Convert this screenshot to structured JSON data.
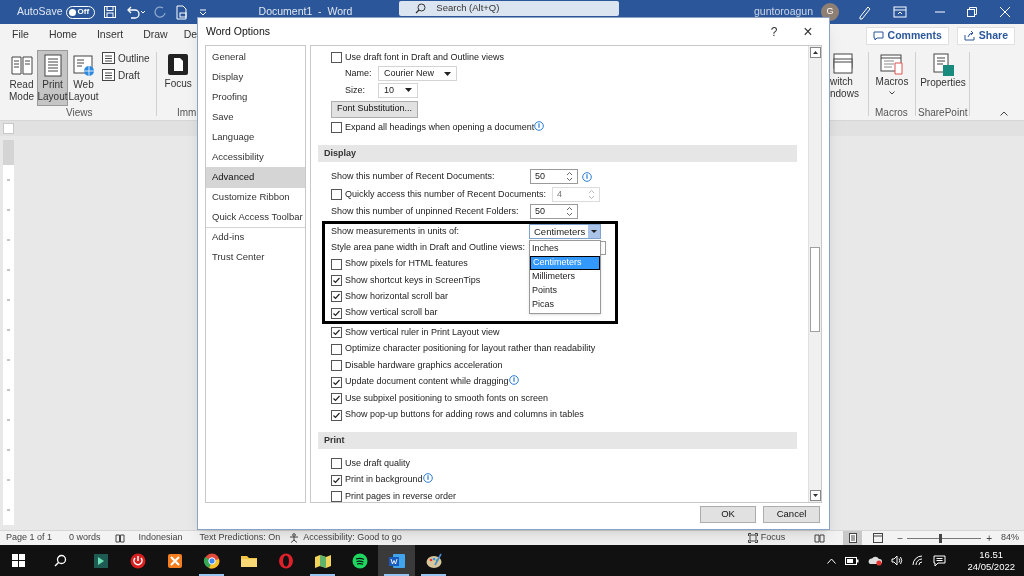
{
  "title_bar": {
    "autosave": "AutoSave",
    "autosave_toggle": {
      "label": "Off",
      "on": false
    },
    "document_title": "Document1  -  Word",
    "search": {
      "placeholder": "Search (Alt+Q)"
    },
    "user_name": "guntoroagun",
    "avatar": "G"
  },
  "ribbon": {
    "tabs": [
      {
        "label": "File",
        "selected": false
      },
      {
        "label": "Home",
        "selected": false
      },
      {
        "label": "Insert",
        "selected": false
      },
      {
        "label": "Draw",
        "selected": false
      },
      {
        "label": "De",
        "selected": false
      }
    ],
    "comments_button": "Comments",
    "share_button": "Share",
    "views": {
      "label": "Views",
      "large_buttons": [
        {
          "label": "Read Mode",
          "selected": false
        },
        {
          "label": "Print Layout",
          "selected": true
        },
        {
          "label": "Web Layout",
          "selected": false
        }
      ],
      "small_buttons": [
        "Outline",
        "Draft"
      ]
    },
    "immersive": {
      "label": "Imm",
      "button": "Focus"
    },
    "window": {
      "lines": [
        "witch",
        "ndows"
      ]
    },
    "macros": {
      "label": "Macros",
      "button": "Macros"
    },
    "sharepoint": {
      "label": "SharePoint",
      "button": "Properties"
    }
  },
  "dialog": {
    "title": "Word Options",
    "help": "?",
    "close": "×",
    "nav": [
      {
        "label": "General",
        "selected": false,
        "divider_above": false
      },
      {
        "label": "Display",
        "selected": false,
        "divider_above": false
      },
      {
        "label": "Proofing",
        "selected": false,
        "divider_above": false
      },
      {
        "label": "Save",
        "selected": false,
        "divider_above": false
      },
      {
        "label": "Language",
        "selected": false,
        "divider_above": false
      },
      {
        "label": "Accessibility",
        "selected": false,
        "divider_above": false
      },
      {
        "label": "Advanced",
        "selected": true,
        "divider_above": false
      },
      {
        "label": "Customize Ribbon",
        "selected": false,
        "divider_above": true
      },
      {
        "label": "Quick Access Toolbar",
        "selected": false,
        "divider_above": false
      },
      {
        "label": "Add-ins",
        "selected": false,
        "divider_above": true
      },
      {
        "label": "Trust Center",
        "selected": false,
        "divider_above": false
      }
    ],
    "rows": [
      {
        "kind": "checkbox",
        "label": "Use draft font in Draft and Outline views",
        "checked": false,
        "info": false
      },
      {
        "kind": "select",
        "label": "Name:",
        "value": "Courier New"
      },
      {
        "kind": "select",
        "label": "Size:",
        "value": "10"
      },
      {
        "kind": "button",
        "label": "Font Substitution..."
      },
      {
        "kind": "checkbox",
        "label": "Expand all headings when opening a document",
        "checked": false,
        "info": true
      },
      {
        "kind": "section",
        "label": "Display"
      },
      {
        "kind": "spin",
        "label": "Show this number of Recent Documents:",
        "value": "50",
        "disabled": false,
        "info": true
      },
      {
        "kind": "check-spin",
        "label": "Quickly access this number of Recent Documents:",
        "checked": false,
        "value": "4",
        "disabled": true
      },
      {
        "kind": "spin",
        "label": "Show this number of unpinned Recent Folders:",
        "value": "50",
        "disabled": false,
        "info": false
      },
      {
        "kind": "highlight",
        "rows": [
          {
            "kind": "dropdown",
            "label": "Show measurements in units of:",
            "value": "Centimeters",
            "expanded": true,
            "options": [
              {
                "label": "Inches",
                "selected": false
              },
              {
                "label": "Centimeters",
                "selected": true
              },
              {
                "label": "Millimeters",
                "selected": false
              },
              {
                "label": "Points",
                "selected": false
              },
              {
                "label": "Picas",
                "selected": false
              }
            ]
          },
          {
            "kind": "field",
            "label": "Style area pane width in Draft and Outline views:"
          },
          {
            "kind": "checkbox",
            "label": "Show pixels for HTML features",
            "checked": false,
            "info": false
          },
          {
            "kind": "checkbox",
            "label": "Show shortcut keys in ScreenTips",
            "checked": true,
            "info": false
          },
          {
            "kind": "checkbox",
            "label": "Show horizontal scroll bar",
            "checked": true,
            "info": false
          },
          {
            "kind": "checkbox",
            "label": "Show vertical scroll bar",
            "checked": true,
            "info": false
          }
        ]
      },
      {
        "kind": "checkbox",
        "label": "Show vertical ruler in Print Layout view",
        "checked": true,
        "info": false
      },
      {
        "kind": "checkbox",
        "label": "Optimize character positioning for layout rather than readability",
        "checked": false,
        "info": false
      },
      {
        "kind": "checkbox",
        "label": "Disable hardware graphics acceleration",
        "checked": false,
        "info": false
      },
      {
        "kind": "checkbox",
        "label": "Update document content while dragging",
        "checked": true,
        "info": true
      },
      {
        "kind": "checkbox",
        "label": "Use subpixel positioning to smooth fonts on screen",
        "checked": true,
        "info": false
      },
      {
        "kind": "checkbox",
        "label": "Show pop-up buttons for adding rows and columns in tables",
        "checked": true,
        "info": false
      },
      {
        "kind": "section",
        "label": "Print"
      },
      {
        "kind": "checkbox",
        "label": "Use draft quality",
        "checked": false,
        "info": false
      },
      {
        "kind": "checkbox",
        "label": "Print in background",
        "checked": true,
        "info": true
      },
      {
        "kind": "checkbox",
        "label": "Print pages in reverse order",
        "checked": false,
        "info": false
      }
    ],
    "buttons": [
      "OK",
      "Cancel"
    ]
  },
  "status_bar": {
    "page": "Page 1 of 1",
    "words": "0 words",
    "language": "Indonesian",
    "text_predictions": "Text Predictions: On",
    "accessibility": "Accessibility: Good to go",
    "focus": "Focus",
    "zoom_out": "−",
    "zoom": {
      "level": 0.43
    },
    "zoom_in": "+",
    "zoom_percent": "84%"
  },
  "taskbar": {
    "apps": [
      {
        "running": false,
        "active": false
      },
      {
        "running": false,
        "active": false
      },
      {
        "running": false,
        "active": false
      },
      {
        "running": true,
        "active": false
      },
      {
        "running": false,
        "active": false
      },
      {
        "running": false,
        "active": false
      },
      {
        "running": true,
        "active": false
      },
      {
        "running": false,
        "active": false
      },
      {
        "running": true,
        "active": true
      },
      {
        "running": true,
        "active": false
      }
    ],
    "time": "16.51",
    "date": "24/05/2022"
  }
}
